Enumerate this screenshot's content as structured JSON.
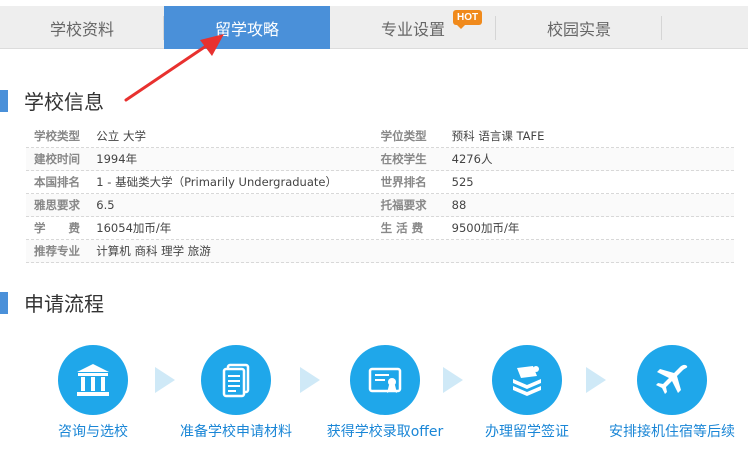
{
  "tabs": [
    {
      "label": "学校资料"
    },
    {
      "label": "留学攻略"
    },
    {
      "label": "专业设置"
    },
    {
      "label": "校园实景"
    }
  ],
  "hot_badge": "HOT",
  "school_info": {
    "title": "学校信息",
    "rows": [
      {
        "l1": "学校类型",
        "v1": "公立 大学",
        "l2": "学位类型",
        "v2": "预科 语言课 TAFE"
      },
      {
        "l1": "建校时间",
        "v1": "1994年",
        "l2": "在校学生",
        "v2": "4276人"
      },
      {
        "l1": "本国排名",
        "v1": "1 - 基础类大学（Primarily Undergraduate）",
        "l2": "世界排名",
        "v2": "525"
      },
      {
        "l1": "雅思要求",
        "v1": "6.5",
        "l2": "托福要求",
        "v2": "88"
      },
      {
        "l1": "学　　费",
        "v1": "16054加币/年",
        "l2": "生 活 费",
        "v2": "9500加币/年"
      },
      {
        "l1": "推荐专业",
        "v1": "计算机 商科 理学 旅游",
        "l2": "",
        "v2": ""
      }
    ]
  },
  "process": {
    "title": "申请流程",
    "steps": [
      {
        "label": "咨询与选校",
        "icon": "institution-icon"
      },
      {
        "label": "准备学校申请材料",
        "icon": "document-icon"
      },
      {
        "label": "获得学校录取offer",
        "icon": "certificate-icon"
      },
      {
        "label": "办理留学签证",
        "icon": "books-icon"
      },
      {
        "label": "安排接机住宿等后续",
        "icon": "airplane-icon"
      }
    ]
  }
}
